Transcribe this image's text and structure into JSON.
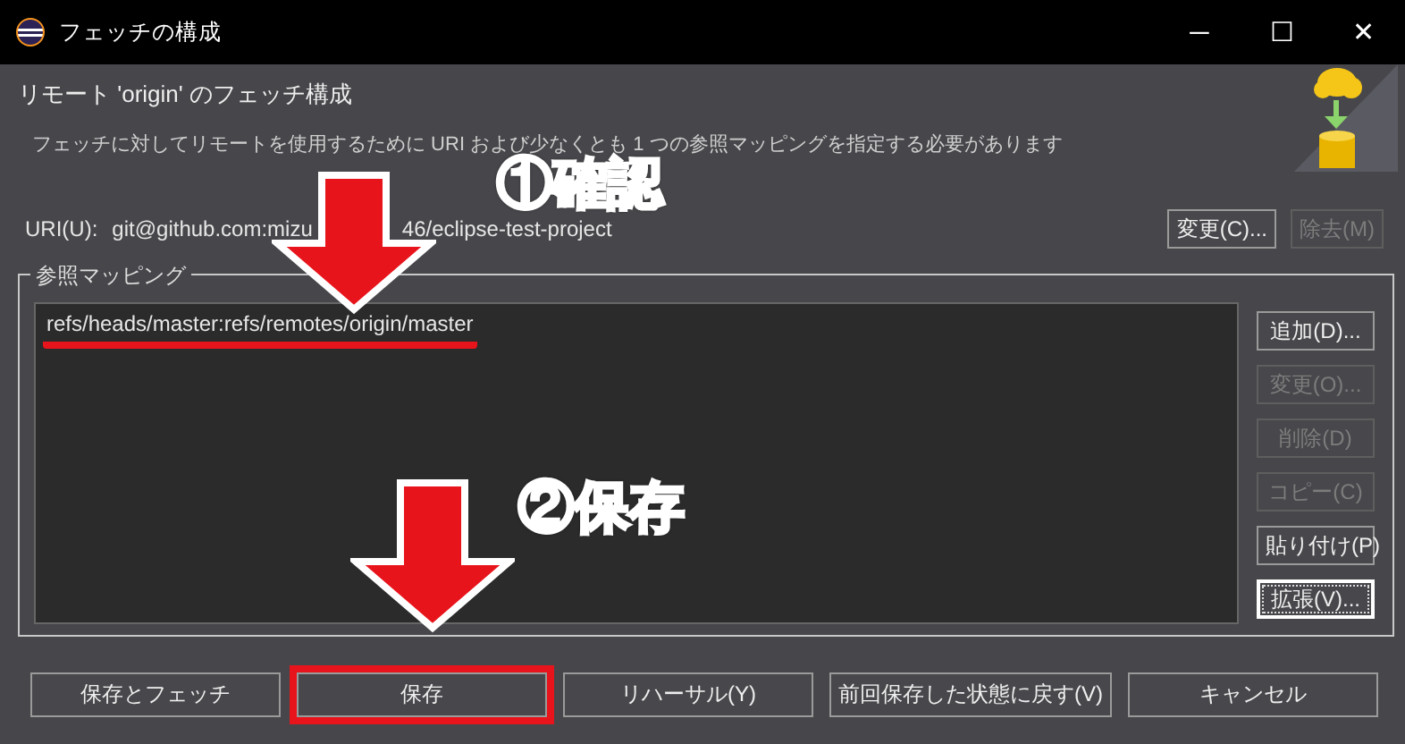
{
  "window": {
    "title": "フェッチの構成",
    "controls": [
      "─",
      "☐",
      "✕"
    ]
  },
  "header": {
    "title": "リモート 'origin' のフェッチ構成",
    "description": "フェッチに対してリモートを使用するために URI および少なくとも 1 つの参照マッピングを指定する必要があります"
  },
  "uri": {
    "label": "URI(U):",
    "value_parts": [
      "git@github.com:mizu",
      "46/eclipse-test-project"
    ],
    "buttons": [
      {
        "label": "変更(C)...",
        "disabled": false
      },
      {
        "label": "除去(M)",
        "disabled": true
      }
    ]
  },
  "ref_mappings": {
    "title": "参照マッピング",
    "items": [
      {
        "text": "refs/heads/master:refs/remotes/origin/master",
        "underlined": true
      }
    ],
    "buttons": [
      {
        "label": "追加(D)...",
        "disabled": false,
        "focused": false
      },
      {
        "label": "変更(O)...",
        "disabled": true,
        "focused": false
      },
      {
        "label": "削除(D)",
        "disabled": true,
        "focused": false
      },
      {
        "label": "コピー(C)",
        "disabled": true,
        "focused": false
      },
      {
        "label": "貼り付け(P)",
        "disabled": false,
        "focused": false
      },
      {
        "label": "拡張(V)...",
        "disabled": false,
        "focused": true
      }
    ]
  },
  "footer_buttons": [
    {
      "label": "保存とフェッチ",
      "highlighted": false
    },
    {
      "label": "保存",
      "highlighted": true
    },
    {
      "label": "リハーサル(Y)",
      "highlighted": false
    },
    {
      "label": "前回保存した状態に戻す(V)",
      "highlighted": false
    },
    {
      "label": "キャンセル",
      "highlighted": false
    }
  ],
  "steps": [
    {
      "label": "①確認"
    },
    {
      "label": "②保存"
    }
  ]
}
